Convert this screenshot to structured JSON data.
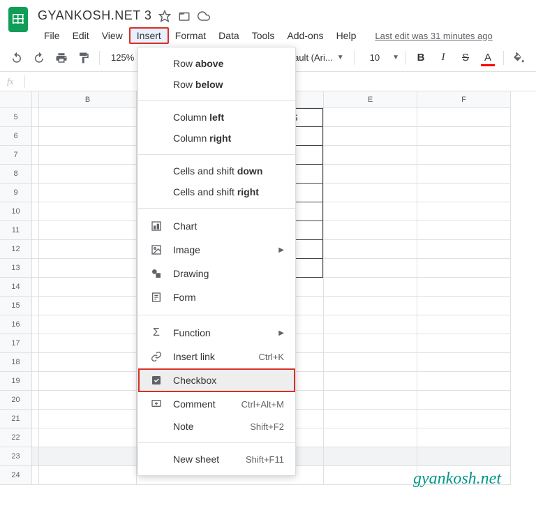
{
  "doc": {
    "title": "GYANKOSH.NET 3",
    "last_edit": "Last edit was 31 minutes ago"
  },
  "menubar": {
    "file": "File",
    "edit": "Edit",
    "view": "View",
    "insert": "Insert",
    "format": "Format",
    "data": "Data",
    "tools": "Tools",
    "addons": "Add-ons",
    "help": "Help"
  },
  "toolbar": {
    "zoom": "125%",
    "font_name": "efault (Ari...",
    "font_size": "10"
  },
  "dropdown": {
    "row_prefix": "Row ",
    "row_above": "above",
    "row_below": "below",
    "col_prefix": "Column ",
    "col_left": "left",
    "col_right": "right",
    "cells_prefix": "Cells and shift ",
    "cells_down": "down",
    "cells_right": "right",
    "chart": "Chart",
    "image": "Image",
    "drawing": "Drawing",
    "form": "Form",
    "function": "Function",
    "insert_link": "Insert link",
    "insert_link_shortcut": "Ctrl+K",
    "checkbox": "Checkbox",
    "comment": "Comment",
    "comment_shortcut": "Ctrl+Alt+M",
    "note": "Note",
    "note_shortcut": "Shift+F2",
    "new_sheet": "New sheet",
    "new_sheet_shortcut": "Shift+F11"
  },
  "columns": {
    "b": "B",
    "e": "E",
    "f": "F"
  },
  "rows": [
    "5",
    "6",
    "7",
    "8",
    "9",
    "10",
    "11",
    "12",
    "13",
    "14",
    "15",
    "16",
    "17",
    "18",
    "19",
    "20",
    "21",
    "22",
    "23",
    "24"
  ],
  "partial_text": "S",
  "watermark": "gyankosh.net"
}
